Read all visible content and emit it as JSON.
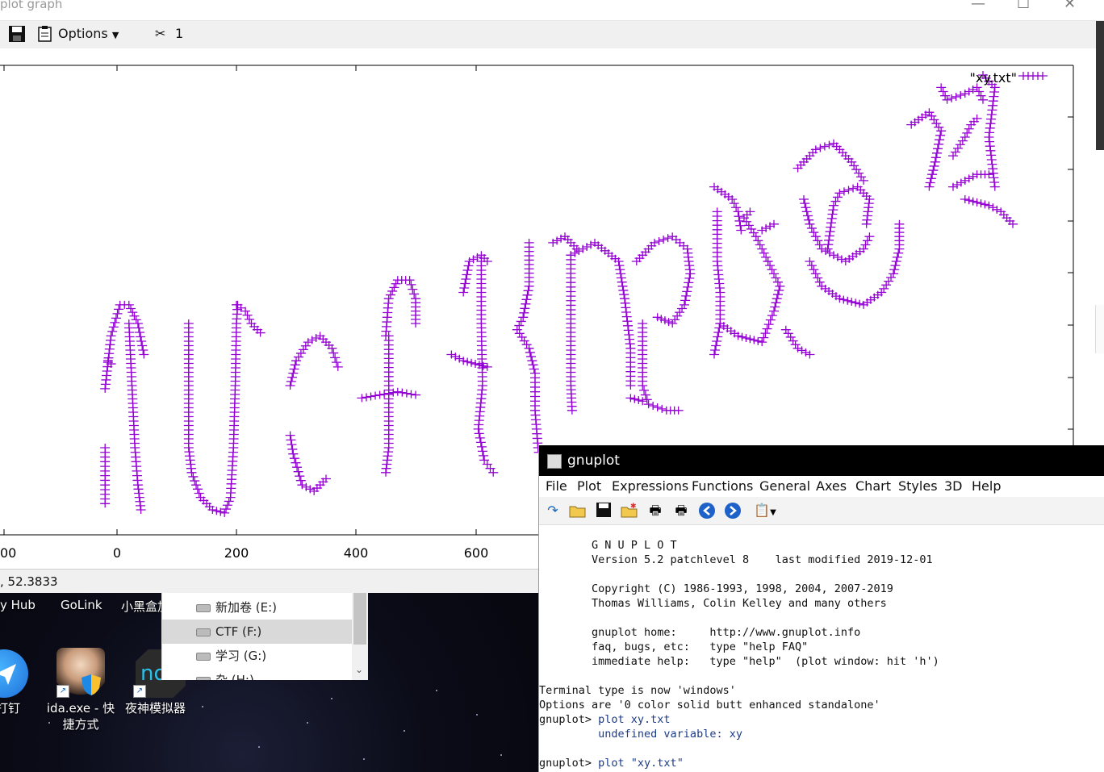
{
  "graph_window": {
    "title": "plot graph",
    "toolbar": {
      "options_label": "Options",
      "item_count": "1"
    },
    "status": ", 52.3833"
  },
  "chart_data": {
    "type": "scatter",
    "legend": "\"xy.txt\"",
    "legend_position": "top-right",
    "x_ticks": [
      "00",
      "0",
      "200",
      "400",
      "600"
    ],
    "grid": false,
    "marker": "plus",
    "color": "#9400d3",
    "series": [
      {
        "name": "\"xy.txt\"",
        "strokes": [
          [
            [
              -20,
              95
            ],
            [
              -10,
              180
            ],
            [
              5,
              230
            ],
            [
              20,
              230
            ],
            [
              35,
              200
            ],
            [
              45,
              150
            ]
          ],
          [
            [
              20,
              200
            ],
            [
              25,
              100
            ],
            [
              30,
              0
            ],
            [
              35,
              -60
            ],
            [
              40,
              -100
            ]
          ],
          [
            [
              -20,
              0
            ],
            [
              -20,
              -60
            ],
            [
              -20,
              -90
            ]
          ],
          [
            [
              -15,
              140
            ],
            [
              -10,
              135
            ]
          ],
          [
            [
              120,
              200
            ],
            [
              120,
              100
            ],
            [
              120,
              0
            ],
            [
              125,
              -40
            ],
            [
              140,
              -80
            ],
            [
              160,
              -100
            ],
            [
              180,
              -105
            ],
            [
              190,
              -80
            ],
            [
              195,
              0
            ],
            [
              198,
              100
            ],
            [
              200,
              200
            ],
            [
              202,
              230
            ]
          ],
          [
            [
              200,
              230
            ],
            [
              215,
              220
            ],
            [
              225,
              200
            ],
            [
              240,
              185
            ]
          ],
          [
            [
              290,
              100
            ],
            [
              300,
              140
            ],
            [
              320,
              170
            ],
            [
              340,
              180
            ],
            [
              360,
              160
            ],
            [
              370,
              130
            ]
          ],
          [
            [
              290,
              20
            ],
            [
              295,
              -10
            ],
            [
              310,
              -60
            ],
            [
              330,
              -70
            ],
            [
              350,
              -50
            ]
          ],
          [
            [
              410,
              80
            ],
            [
              440,
              85
            ],
            [
              470,
              90
            ],
            [
              500,
              85
            ]
          ],
          [
            [
              450,
              180
            ],
            [
              455,
              240
            ],
            [
              470,
              270
            ],
            [
              490,
              270
            ],
            [
              500,
              240
            ],
            [
              500,
              200
            ]
          ],
          [
            [
              455,
              180
            ],
            [
              455,
              100
            ],
            [
              455,
              0
            ],
            [
              450,
              -40
            ]
          ],
          [
            [
              560,
              150
            ],
            [
              580,
              140
            ],
            [
              600,
              135
            ],
            [
              620,
              130
            ]
          ],
          [
            [
              580,
              250
            ],
            [
              590,
              300
            ],
            [
              610,
              310
            ],
            [
              620,
              300
            ]
          ],
          [
            [
              610,
              300
            ],
            [
              610,
              200
            ],
            [
              612,
              100
            ],
            [
              605,
              30
            ],
            [
              615,
              -20
            ],
            [
              630,
              -40
            ]
          ],
          [
            [
              690,
              330
            ],
            [
              690,
              260
            ],
            [
              680,
              210
            ],
            [
              670,
              190
            ],
            [
              690,
              160
            ],
            [
              700,
              120
            ],
            [
              700,
              60
            ],
            [
              705,
              0
            ],
            [
              710,
              -30
            ],
            [
              730,
              -40
            ]
          ],
          [
            [
              730,
              330
            ],
            [
              750,
              340
            ],
            [
              770,
              320
            ]
          ],
          [
            [
              760,
              310
            ],
            [
              800,
              330
            ],
            [
              840,
              300
            ],
            [
              850,
              240
            ],
            [
              860,
              160
            ],
            [
              860,
              100
            ]
          ],
          [
            [
              760,
              310
            ],
            [
              760,
              200
            ],
            [
              760,
              100
            ],
            [
              762,
              60
            ]
          ],
          [
            [
              870,
              300
            ],
            [
              900,
              330
            ],
            [
              930,
              340
            ],
            [
              955,
              320
            ],
            [
              960,
              280
            ],
            [
              950,
              230
            ],
            [
              930,
              200
            ],
            [
              905,
              210
            ]
          ],
          [
            [
              880,
              200
            ],
            [
              880,
              150
            ],
            [
              880,
              100
            ],
            [
              890,
              70
            ],
            [
              920,
              60
            ],
            [
              940,
              60
            ]
          ],
          [
            [
              860,
              80
            ],
            [
              880,
              75
            ]
          ],
          [
            [
              1000,
              420
            ],
            [
              1030,
              400
            ],
            [
              1040,
              380
            ],
            [
              1045,
              350
            ]
          ],
          [
            [
              1005,
              380
            ],
            [
              1005,
              300
            ],
            [
              1010,
              250
            ],
            [
              1010,
              200
            ],
            [
              1000,
              150
            ]
          ],
          [
            [
              1010,
              200
            ],
            [
              1040,
              180
            ],
            [
              1080,
              170
            ],
            [
              1100,
              220
            ],
            [
              1110,
              260
            ],
            [
              1090,
              300
            ]
          ],
          [
            [
              1090,
              300
            ],
            [
              1070,
              340
            ],
            [
              1050,
              370
            ],
            [
              1060,
              380
            ]
          ],
          [
            [
              1120,
              190
            ],
            [
              1140,
              160
            ],
            [
              1160,
              150
            ]
          ],
          [
            [
              1080,
              350
            ],
            [
              1100,
              360
            ]
          ],
          [
            [
              1140,
              450
            ],
            [
              1170,
              480
            ],
            [
              1200,
              490
            ],
            [
              1230,
              460
            ],
            [
              1250,
              430
            ]
          ],
          [
            [
              1150,
              400
            ],
            [
              1160,
              360
            ],
            [
              1180,
              320
            ],
            [
              1220,
              300
            ],
            [
              1250,
              320
            ],
            [
              1260,
              340
            ]
          ],
          [
            [
              1160,
              300
            ],
            [
              1180,
              260
            ],
            [
              1210,
              240
            ],
            [
              1250,
              230
            ],
            [
              1280,
              250
            ],
            [
              1300,
              280
            ],
            [
              1310,
              320
            ],
            [
              1310,
              360
            ]
          ],
          [
            [
              1190,
              320
            ],
            [
              1200,
              390
            ],
            [
              1210,
              410
            ],
            [
              1240,
              420
            ],
            [
              1260,
              400
            ],
            [
              1255,
              360
            ]
          ],
          [
            [
              1330,
              520
            ],
            [
              1360,
              540
            ],
            [
              1380,
              510
            ],
            [
              1370,
              460
            ],
            [
              1360,
              420
            ]
          ],
          [
            [
              1380,
              580
            ],
            [
              1390,
              560
            ],
            [
              1420,
              570
            ],
            [
              1440,
              580
            ],
            [
              1450,
              560
            ]
          ],
          [
            [
              1450,
              600
            ],
            [
              1470,
              580
            ],
            [
              1460,
              500
            ],
            [
              1470,
              420
            ]
          ],
          [
            [
              1400,
              470
            ],
            [
              1420,
              500
            ],
            [
              1430,
              520
            ],
            [
              1440,
              530
            ]
          ],
          [
            [
              1400,
              420
            ],
            [
              1440,
              440
            ],
            [
              1460,
              440
            ]
          ],
          [
            [
              1420,
              400
            ],
            [
              1460,
              390
            ],
            [
              1480,
              380
            ],
            [
              1500,
              360
            ]
          ]
        ]
      }
    ]
  },
  "desktop": {
    "icons_row1": [
      "y Hub",
      "GoLink",
      "小黑盒加"
    ],
    "icons_row2": [
      {
        "label": "打钉",
        "icon": "pin-app-icon"
      },
      {
        "label": "ida.exe - 快\n捷方式",
        "icon": "ida-icon"
      },
      {
        "label": "夜神模拟器",
        "icon": "nox-icon"
      }
    ],
    "drives": [
      "新加卷 (E:)",
      "CTF (F:)",
      "学习 (G:)",
      "杂 (H:)"
    ]
  },
  "console": {
    "title": "gnuplot",
    "menu": [
      "File",
      "Plot",
      "Expressions",
      "Functions",
      "General",
      "Axes",
      "Chart",
      "Styles",
      "3D",
      "Help"
    ],
    "lines": [
      "        G N U P L O T",
      "        Version 5.2 patchlevel 8    last modified 2019-12-01",
      "",
      "        Copyright (C) 1986-1993, 1998, 2004, 2007-2019",
      "        Thomas Williams, Colin Kelley and many others",
      "",
      "        gnuplot home:     http://www.gnuplot.info",
      "        faq, bugs, etc:   type \"help FAQ\"",
      "        immediate help:   type \"help\"  (plot window: hit 'h')",
      "",
      "Terminal type is now 'windows'",
      "Options are '0 color solid butt enhanced standalone'",
      "gnuplot> plot xy.txt",
      "         undefined variable: xy",
      "",
      "gnuplot> plot \"xy.txt\""
    ]
  }
}
